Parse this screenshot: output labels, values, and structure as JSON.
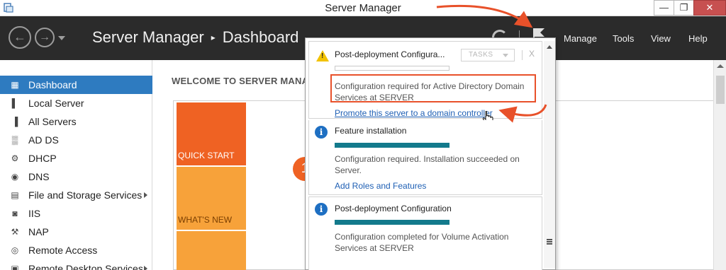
{
  "window": {
    "title": "Server Manager",
    "buttons": {
      "minimize": "—",
      "maximize": "❐",
      "close": "✕"
    }
  },
  "header": {
    "breadcrumb_root": "Server Manager",
    "breadcrumb_separator": "▸",
    "breadcrumb_current": "Dashboard",
    "menus": [
      "Manage",
      "Tools",
      "View",
      "Help"
    ]
  },
  "sidebar": {
    "items": [
      {
        "label": "Dashboard",
        "icon": "dashboard-icon",
        "glyph": "▦",
        "active": true,
        "has_submenu": false
      },
      {
        "label": "Local Server",
        "icon": "local-server-icon",
        "glyph": "▌",
        "active": false,
        "has_submenu": false
      },
      {
        "label": "All Servers",
        "icon": "all-servers-icon",
        "glyph": "▐",
        "active": false,
        "has_submenu": false
      },
      {
        "label": "AD DS",
        "icon": "ad-ds-icon",
        "glyph": "▒",
        "active": false,
        "has_submenu": false
      },
      {
        "label": "DHCP",
        "icon": "dhcp-icon",
        "glyph": "⚙",
        "active": false,
        "has_submenu": false
      },
      {
        "label": "DNS",
        "icon": "dns-icon",
        "glyph": "◉",
        "active": false,
        "has_submenu": false
      },
      {
        "label": "File and Storage Services",
        "icon": "file-storage-icon",
        "glyph": "▤",
        "active": false,
        "has_submenu": true
      },
      {
        "label": "IIS",
        "icon": "iis-icon",
        "glyph": "◙",
        "active": false,
        "has_submenu": false
      },
      {
        "label": "NAP",
        "icon": "nap-icon",
        "glyph": "⚒",
        "active": false,
        "has_submenu": false
      },
      {
        "label": "Remote Access",
        "icon": "remote-access-icon",
        "glyph": "◎",
        "active": false,
        "has_submenu": false
      },
      {
        "label": "Remote Desktop Services",
        "icon": "remote-desktop-icon",
        "glyph": "▣",
        "active": false,
        "has_submenu": true
      }
    ]
  },
  "main": {
    "welcome": "WELCOME TO SERVER MANA",
    "tiles": {
      "quick_start": "QUICK START",
      "whats_new": "WHAT'S NEW"
    },
    "step_number": "1"
  },
  "notifications": {
    "cards": [
      {
        "icon": "warning-icon",
        "title": "Post-deployment Configura...",
        "tasks_label": "TASKS",
        "close_label": "X",
        "description": "Configuration required for Active Directory Domain Services at SERVER",
        "link": "Promote this server to a domain controller"
      },
      {
        "icon": "info-icon",
        "title": "Feature installation",
        "progress_pct": 100,
        "description": "Configuration required. Installation succeeded on Server.",
        "link": "Add Roles and Features"
      },
      {
        "icon": "info-icon",
        "title": "Post-deployment Configuration",
        "progress_pct": 100,
        "description": "Configuration completed for Volume Activation Services at SERVER"
      }
    ]
  },
  "colors": {
    "header_bg": "#2b2b2b",
    "accent_blue": "#2e7bc0",
    "quick_start": "#ef6223",
    "whats_new": "#f7a23a",
    "progress_teal": "#137a8c",
    "annotation_red": "#e8512a",
    "link_blue": "#1e5fb4"
  }
}
